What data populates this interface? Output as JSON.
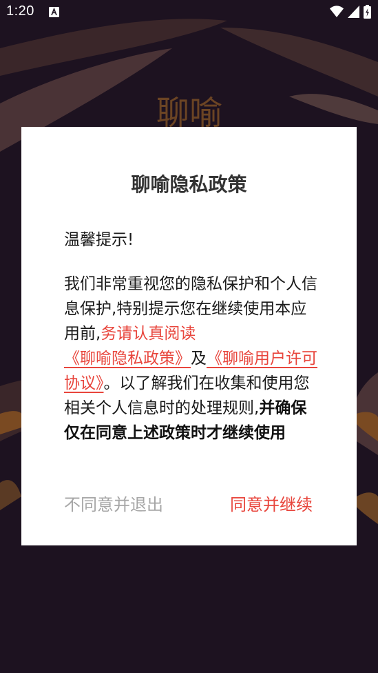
{
  "status_bar": {
    "time": "1:20",
    "notification_icon": "text-a-icon",
    "wifi_icon": "wifi-icon",
    "signal_icon": "signal-icon",
    "battery_icon": "battery-charging-icon"
  },
  "background": {
    "logo_text": "聊喻",
    "colors": {
      "base": "#1d1220",
      "leaf_brown": "#4a3336",
      "leaf_orange": "#7a4a22"
    }
  },
  "dialog": {
    "title": "聊喻隐私政策",
    "greeting": "温馨提示!",
    "body": {
      "part1": "我们非常重视您的隐私保护和个人信息保护,特别提示您在继续使用本应用前,",
      "warning": "务请认真阅读",
      "privacy_link": "《聊喻隐私政策》",
      "and_text": "及",
      "license_link": "《聊喻用户许可协议》",
      "part2": "。以了解我们在收集和使用您相关个人信息时的处理规则,",
      "bold": "并确保仅在同意上述政策时才继续使用"
    },
    "decline_label": "不同意并退出",
    "agree_label": "同意并继续",
    "colors": {
      "accent": "#e8453c",
      "muted": "#a6a6a6",
      "title": "#333333"
    }
  }
}
